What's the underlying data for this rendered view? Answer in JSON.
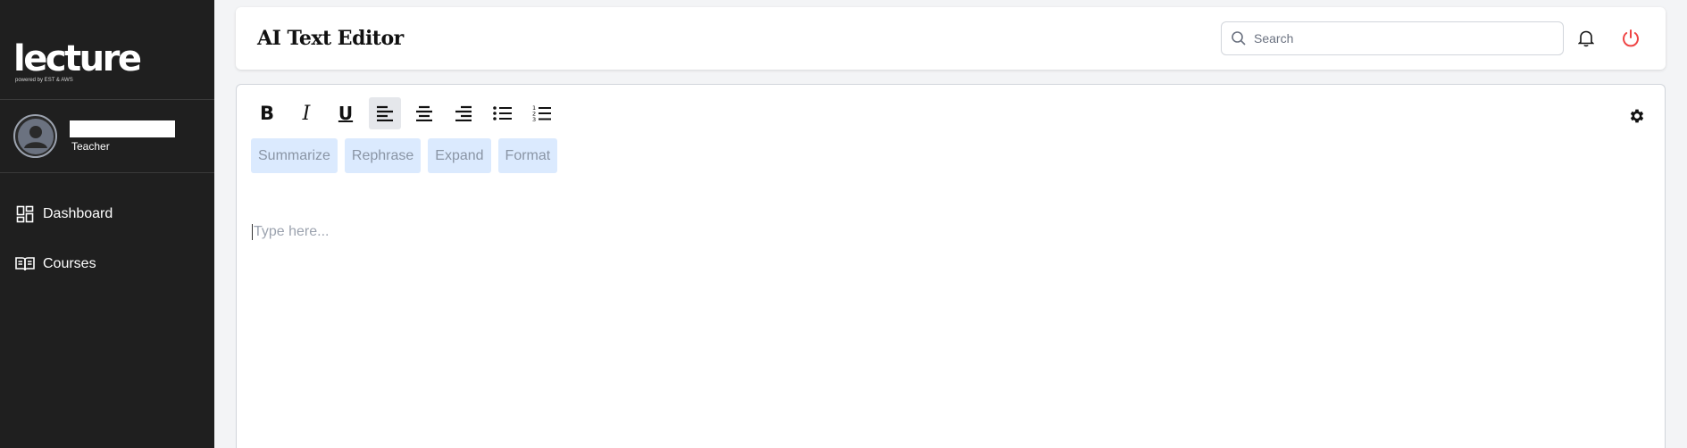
{
  "sidebar": {
    "logo": "lecture",
    "logo_sub": "powered by EST & AWS",
    "profile": {
      "name": "",
      "role": "Teacher"
    },
    "nav": [
      {
        "label": "Dashboard",
        "icon": "dashboard-icon"
      },
      {
        "label": "Courses",
        "icon": "book-icon"
      }
    ]
  },
  "header": {
    "title": "AI Text Editor",
    "search_placeholder": "Search",
    "search_value": ""
  },
  "editor": {
    "toolbar": [
      "bold",
      "italic",
      "underline",
      "align-left",
      "align-center",
      "align-right",
      "bullet-list",
      "numbered-list"
    ],
    "active_tool": "align-left",
    "ai_actions": {
      "summarize": "Summarize",
      "rephrase": "Rephrase",
      "expand": "Expand",
      "format": "Format"
    },
    "placeholder": "Type here..."
  },
  "colors": {
    "sidebar_bg": "#1f1f1f",
    "ai_button_bg": "#dbeafe",
    "power_icon": "#ef4444"
  }
}
